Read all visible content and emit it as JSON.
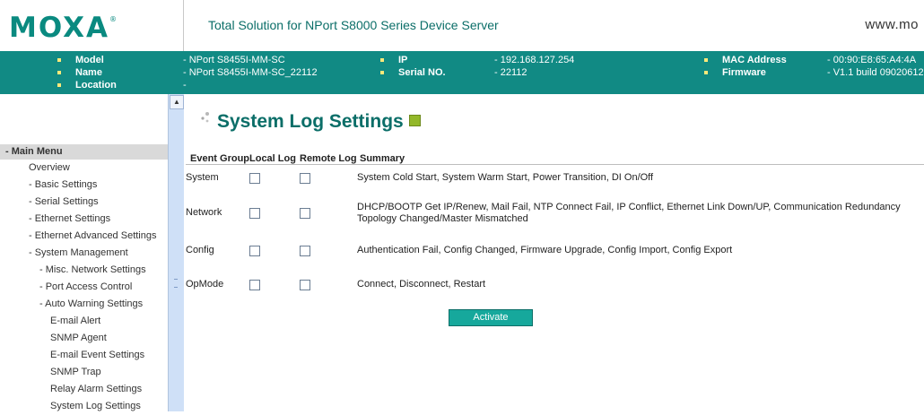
{
  "header": {
    "logo_text": "MOXA",
    "logo_reg": "®",
    "product_title": "Total Solution for NPort S8000 Series Device Server",
    "web_link": "www.mo"
  },
  "info": {
    "model_label": "Model",
    "model_value": "- NPort S8455I-MM-SC",
    "name_label": "Name",
    "name_value": "- NPort S8455I-MM-SC_22112",
    "location_label": "Location",
    "location_value": "-",
    "ip_label": "IP",
    "ip_value": "- 192.168.127.254",
    "serial_label": "Serial NO.",
    "serial_value": "- 22112",
    "mac_label": "MAC Address",
    "mac_value": "- 00:90:E8:65:A4:4A",
    "firmware_label": "Firmware",
    "firmware_value": "- V1.1 build 09020612"
  },
  "nav": {
    "menu_header": "- Main Menu",
    "items": [
      "Overview",
      "- Basic Settings",
      "- Serial Settings",
      "- Ethernet Settings",
      "- Ethernet Advanced Settings",
      "- System Management",
      "- Misc. Network Settings",
      "- Port Access Control",
      "- Auto Warning Settings",
      "E-mail Alert",
      "SNMP Agent",
      "E-mail Event Settings",
      "SNMP Trap",
      "Relay Alarm Settings",
      "System Log Settings"
    ]
  },
  "main": {
    "title": "System Log Settings",
    "columns": [
      "Event Group",
      "Local Log",
      "Remote Log",
      "Summary"
    ],
    "rows": [
      {
        "group": "System",
        "local": false,
        "remote": false,
        "summary": "System Cold Start, System Warm Start, Power Transition, DI On/Off"
      },
      {
        "group": "Network",
        "local": false,
        "remote": false,
        "summary": "DHCP/BOOTP Get IP/Renew, Mail Fail, NTP Connect Fail, IP Conflict, Ethernet Link Down/UP, Communication Redundancy Topology Changed/Master Mismatched"
      },
      {
        "group": "Config",
        "local": false,
        "remote": false,
        "summary": "Authentication Fail, Config Changed, Firmware Upgrade, Config Import, Config Export"
      },
      {
        "group": "OpMode",
        "local": false,
        "remote": false,
        "summary": "Connect, Disconnect, Restart"
      }
    ],
    "activate_label": "Activate"
  },
  "colors": {
    "brand_teal": "#0a8a80",
    "infobar": "#118a84",
    "bullet": "#ffe97a",
    "button": "#16a89c"
  }
}
